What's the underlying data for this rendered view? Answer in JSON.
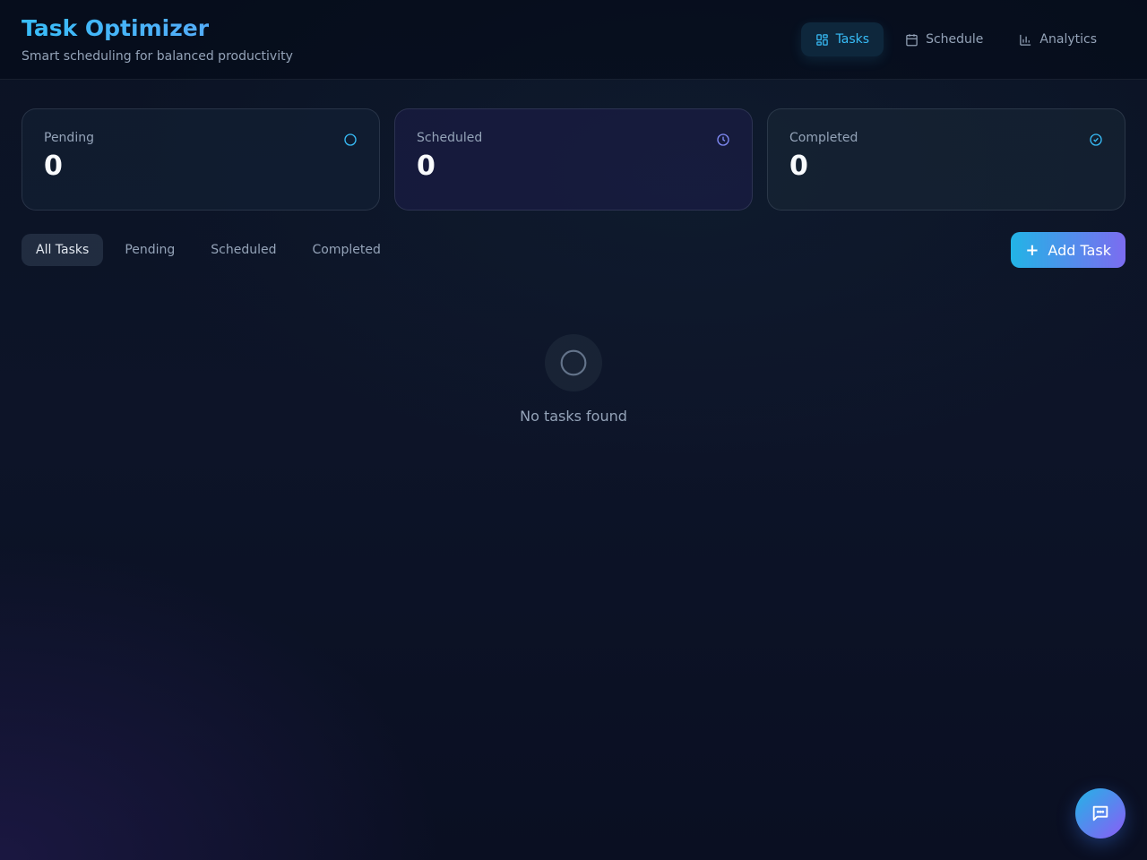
{
  "header": {
    "title": "Task Optimizer",
    "subtitle": "Smart scheduling for balanced productivity",
    "nav": [
      {
        "label": "Tasks",
        "icon": "grid-icon",
        "active": true
      },
      {
        "label": "Schedule",
        "icon": "calendar-icon",
        "active": false
      },
      {
        "label": "Analytics",
        "icon": "bar-chart-icon",
        "active": false
      }
    ]
  },
  "stats": [
    {
      "label": "Pending",
      "value": "0",
      "icon": "circle-icon"
    },
    {
      "label": "Scheduled",
      "value": "0",
      "icon": "clock-icon"
    },
    {
      "label": "Completed",
      "value": "0",
      "icon": "check-circle-icon"
    }
  ],
  "filters": [
    "All Tasks",
    "Pending",
    "Scheduled",
    "Completed"
  ],
  "active_filter": "All Tasks",
  "add_task_label": "Add Task",
  "empty_state": {
    "text": "No tasks found",
    "icon": "circle-icon"
  },
  "chat_button": {
    "icon": "chat-icon"
  },
  "colors": {
    "accent": "#38bdf8",
    "accent_purple": "#7c6cf0",
    "muted_text": "#94a3b8"
  }
}
